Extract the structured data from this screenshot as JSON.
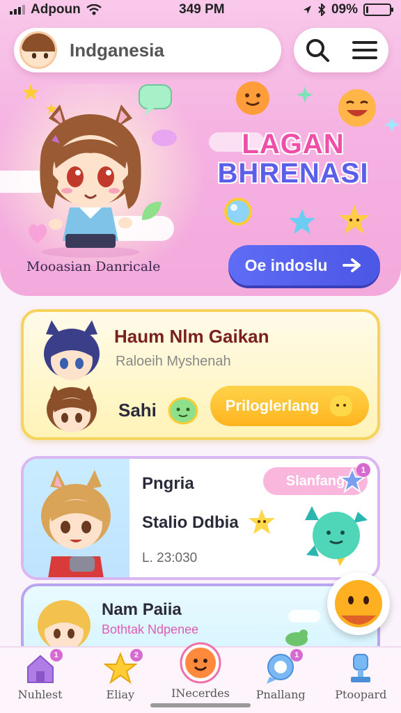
{
  "status_bar": {
    "carrier": "Adpoun",
    "time": "349 PM",
    "battery": "09%",
    "battery_level": 0.09
  },
  "header": {
    "search_text": "Indganesia",
    "search_icon": "search-icon",
    "menu_icon": "menu-icon"
  },
  "hero": {
    "character_caption": "Mooasian Danricale",
    "title_line1": "LAGAN",
    "title_line2": "BHRENASI",
    "cta_label": "Oe indoslu",
    "cta_icon": "arrow-icon",
    "colors": {
      "accent": "#5b5ee8",
      "pink": "#f04fa8"
    }
  },
  "card_yellow": {
    "title": "Haum Nlm Gaikan",
    "subtitle": "Raloeih Myshenah",
    "name": "Sahi",
    "button_label": "Priloglerlang"
  },
  "card_purple": {
    "title": "Pngria",
    "subtitle": "Stalio Ddbia",
    "meta": "L. 23:030",
    "chip_label": "Slanfang",
    "chip_badge": "1"
  },
  "card_blue": {
    "title": "Nam Paiia",
    "subtitle": "Bothtak Ndpenee"
  },
  "bottom_nav": {
    "items": [
      {
        "label": "Nuhlest",
        "icon": "home-icon",
        "badge": "1"
      },
      {
        "label": "Eliay",
        "icon": "star-icon",
        "badge": "2"
      },
      {
        "label": "INecerdes",
        "icon": "smiley-icon",
        "badge": ""
      },
      {
        "label": "Pnallang",
        "icon": "chat-icon",
        "badge": "1"
      },
      {
        "label": "Ptoopard",
        "icon": "trophy-icon",
        "badge": ""
      }
    ]
  }
}
